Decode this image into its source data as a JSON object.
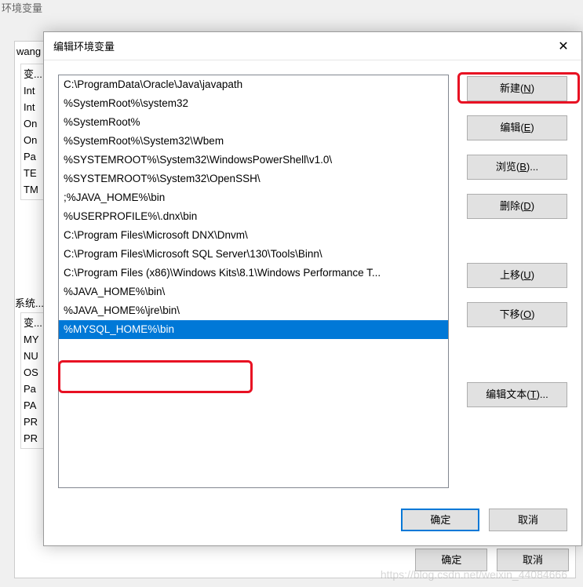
{
  "outer": {
    "title": "环境变量",
    "user_label": "wang",
    "user_rows": [
      "变...",
      "Int",
      "Int",
      "On",
      "On",
      "Pa",
      "TE",
      "TM"
    ],
    "sys_label": "系统...",
    "sys_rows": [
      "变...",
      "MY",
      "NU",
      "OS",
      "Pa",
      "PA",
      "PR",
      "PR"
    ],
    "ok": "确定",
    "cancel": "取消"
  },
  "inner": {
    "title": "编辑环境变量",
    "close": "✕",
    "items": [
      "C:\\ProgramData\\Oracle\\Java\\javapath",
      "%SystemRoot%\\system32",
      "%SystemRoot%",
      "%SystemRoot%\\System32\\Wbem",
      "%SYSTEMROOT%\\System32\\WindowsPowerShell\\v1.0\\",
      "%SYSTEMROOT%\\System32\\OpenSSH\\",
      ";%JAVA_HOME%\\bin",
      "%USERPROFILE%\\.dnx\\bin",
      "C:\\Program Files\\Microsoft DNX\\Dnvm\\",
      "C:\\Program Files\\Microsoft SQL Server\\130\\Tools\\Binn\\",
      "C:\\Program Files (x86)\\Windows Kits\\8.1\\Windows Performance T...",
      "%JAVA_HOME%\\bin\\",
      "%JAVA_HOME%\\jre\\bin\\",
      "%MYSQL_HOME%\\bin"
    ],
    "selected_index": 13,
    "buttons": {
      "new": "新建(N)",
      "edit": "编辑(E)",
      "browse": "浏览(B)...",
      "delete": "删除(D)",
      "up": "上移(U)",
      "down": "下移(O)",
      "edit_text": "编辑文本(T)..."
    },
    "ok": "确定",
    "cancel": "取消"
  },
  "watermark": "https://blog.csdn.net/weixin_44084666"
}
